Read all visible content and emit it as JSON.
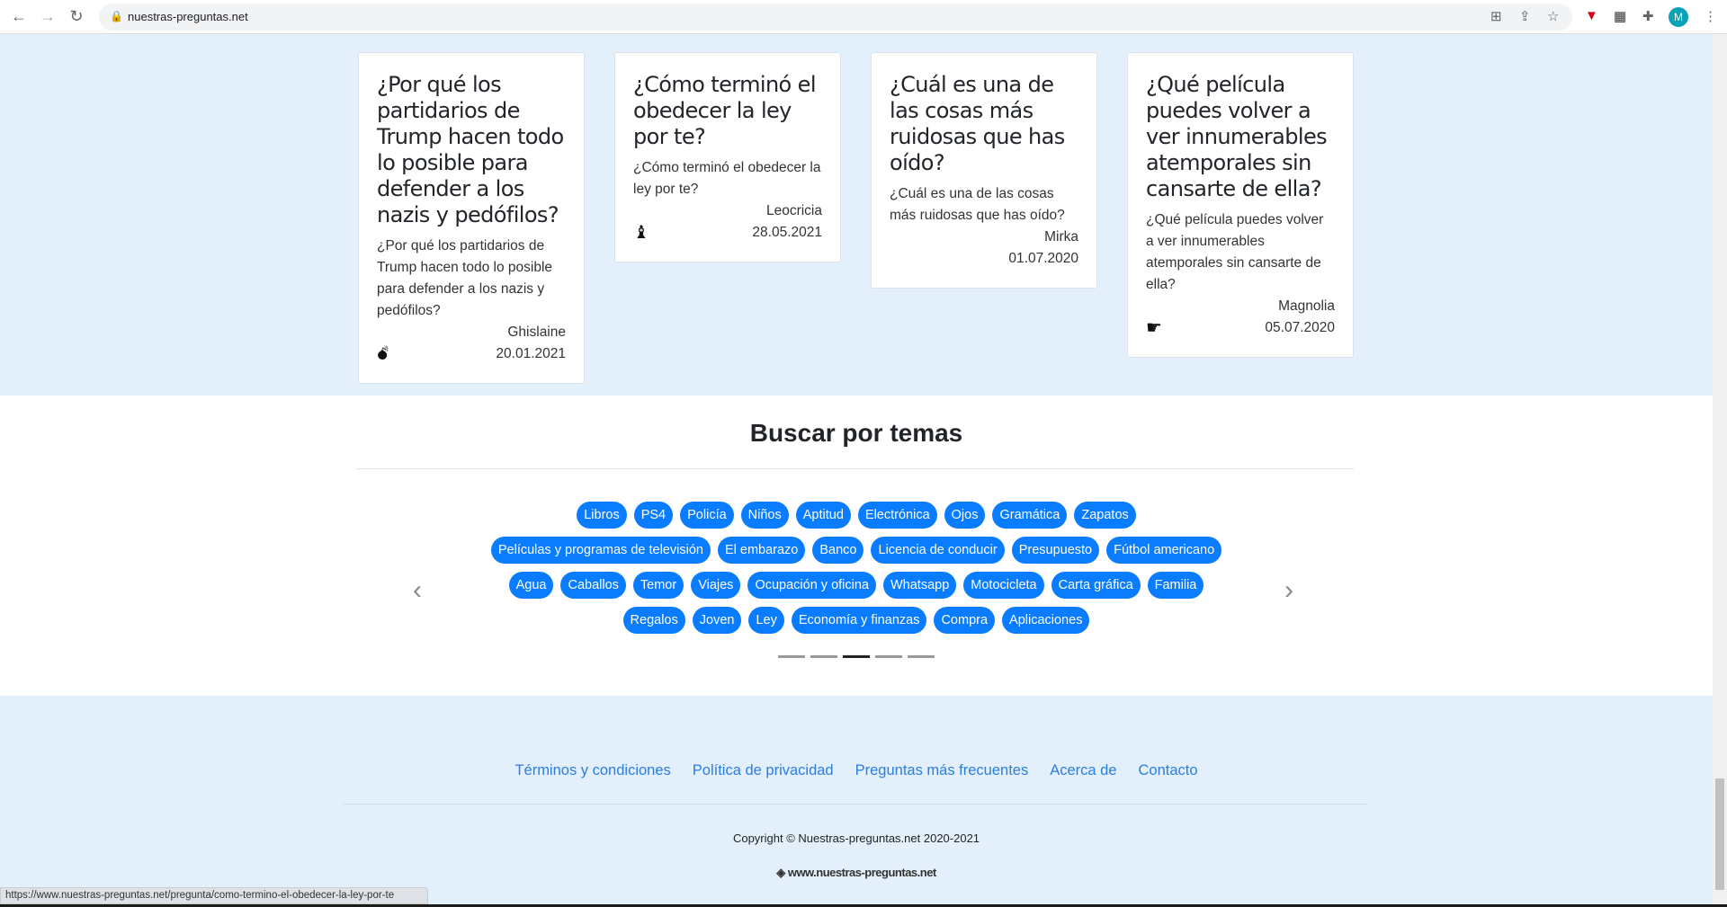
{
  "browser": {
    "url": "nuestras-preguntas.net",
    "avatar_letter": "M",
    "status_url": "https://www.nuestras-preguntas.net/pregunta/como-termino-el-obedecer-la-ley-por-te"
  },
  "cards": [
    {
      "title": "¿Por qué los partidarios de Trump hacen todo lo posible para defender a los nazis y pedófilos?",
      "excerpt": "¿Por qué los partidarios de Trump hacen todo lo posible para defender a los nazis y pedófilos?",
      "author": "Ghislaine",
      "date": "20.01.2021",
      "icon": "bomb-icon"
    },
    {
      "title": "¿Cómo terminó el obedecer la ley por te?",
      "excerpt": "¿Cómo terminó el obedecer la ley por te?",
      "author": "Leocricia",
      "date": "28.05.2021",
      "icon": "chess-bishop-icon"
    },
    {
      "title": "¿Cuál es una de las cosas más ruidosas que has oído?",
      "excerpt": "¿Cuál es una de las cosas más ruidosas que has oído?",
      "author": "Mirka",
      "date": "01.07.2020",
      "icon": ""
    },
    {
      "title": "¿Qué película puedes volver a ver innumerables atemporales sin cansarte de ella?",
      "excerpt": "¿Qué película puedes volver a ver innumerables atemporales sin cansarte de ella?",
      "author": "Magnolia",
      "date": "05.07.2020",
      "icon": "hand-pointing-right-icon"
    }
  ],
  "topics": {
    "heading": "Buscar por temas",
    "rows": [
      [
        "Libros",
        "PS4",
        "Policía",
        "Niños",
        "Aptitud",
        "Electrónica",
        "Ojos",
        "Gramática",
        "Zapatos"
      ],
      [
        "Películas y programas de televisión",
        "El embarazo",
        "Banco",
        "Licencia de conducir",
        "Presupuesto",
        "Fútbol americano"
      ],
      [
        "Agua",
        "Caballos",
        "Temor",
        "Viajes",
        "Ocupación y oficina",
        "Whatsapp",
        "Motocicleta",
        "Carta gráfica",
        "Familia"
      ],
      [
        "Regalos",
        "Joven",
        "Ley",
        "Economía y finanzas",
        "Compra",
        "Aplicaciones"
      ]
    ],
    "carousel_active_index": 2,
    "carousel_count": 5
  },
  "footer": {
    "links": [
      "Términos y condiciones",
      "Política de privacidad",
      "Preguntas más frecuentes",
      "Acerca de",
      "Contacto"
    ],
    "copyright": "Copyright © Nuestras-preguntas.net 2020-2021",
    "logo_text": "www.nuestras-preguntas.net"
  }
}
